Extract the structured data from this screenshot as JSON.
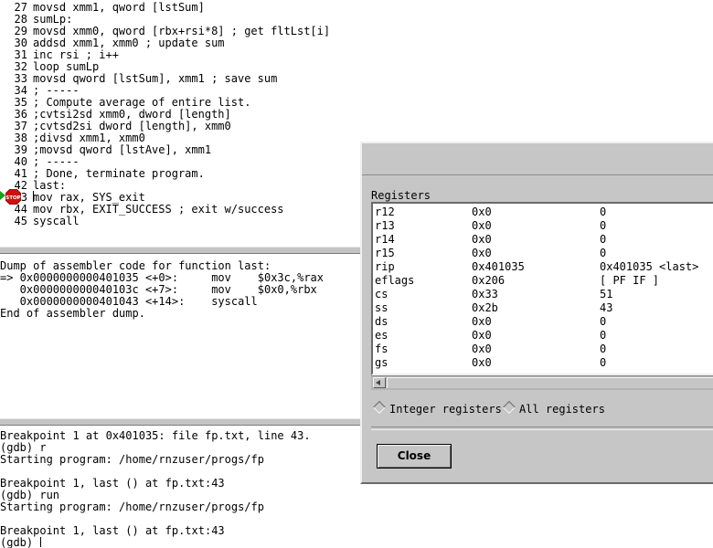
{
  "source": {
    "lines": [
      {
        "num": "27",
        "text": "movsd xmm1, qword [lstSum]"
      },
      {
        "num": "28",
        "text": "sumLp:"
      },
      {
        "num": "29",
        "text": "movsd xmm0, qword [rbx+rsi*8] ; get fltLst[i]"
      },
      {
        "num": "30",
        "text": "addsd xmm1, xmm0 ; update sum"
      },
      {
        "num": "31",
        "text": "inc rsi ; i++"
      },
      {
        "num": "32",
        "text": "loop sumLp"
      },
      {
        "num": "33",
        "text": "movsd qword [lstSum], xmm1 ; save sum"
      },
      {
        "num": "34",
        "text": "; -----"
      },
      {
        "num": "35",
        "text": "; Compute average of entire list."
      },
      {
        "num": "36",
        "text": ";cvtsi2sd xmm0, dword [length]"
      },
      {
        "num": "37",
        "text": ";cvtsd2si dword [length], xmm0"
      },
      {
        "num": "38",
        "text": ";divsd xmm1, xmm0"
      },
      {
        "num": "39",
        "text": ";movsd qword [lstAve], xmm1"
      },
      {
        "num": "40",
        "text": "; -----"
      },
      {
        "num": "41",
        "text": "; Done, terminate program."
      },
      {
        "num": "42",
        "text": "last:"
      },
      {
        "num": "43",
        "text": "mov rax, SYS_exit"
      },
      {
        "num": "44",
        "text": "mov rbx, EXIT_SUCCESS ; exit w/success"
      },
      {
        "num": "45",
        "text": "syscall"
      }
    ],
    "stop_label": "STOP"
  },
  "assembly": {
    "lines": [
      "Dump of assembler code for function last:",
      "=> 0x0000000000401035 <+0>:     mov    $0x3c,%rax",
      "   0x000000000040103c <+7>:     mov    $0x0,%rbx",
      "   0x0000000000401043 <+14>:    syscall",
      "End of assembler dump."
    ]
  },
  "console": {
    "lines": [
      "Breakpoint 1 at 0x401035: file fp.txt, line 43.",
      "(gdb) r",
      "Starting program: /home/rnzuser/progs/fp",
      "",
      "Breakpoint 1, last () at fp.txt:43",
      "(gdb) run",
      "Starting program: /home/rnzuser/progs/fp",
      "",
      "Breakpoint 1, last () at fp.txt:43",
      "(gdb) "
    ]
  },
  "registers_dialog": {
    "title": "Registers",
    "rows": [
      {
        "name": "r12",
        "hex": "0x0",
        "natural": "0"
      },
      {
        "name": "r13",
        "hex": "0x0",
        "natural": "0"
      },
      {
        "name": "r14",
        "hex": "0x0",
        "natural": "0"
      },
      {
        "name": "r15",
        "hex": "0x0",
        "natural": "0"
      },
      {
        "name": "rip",
        "hex": "0x401035",
        "natural": "0x401035 <last>"
      },
      {
        "name": "eflags",
        "hex": "0x206",
        "natural": "[ PF IF ]"
      },
      {
        "name": "cs",
        "hex": "0x33",
        "natural": "51"
      },
      {
        "name": "ss",
        "hex": "0x2b",
        "natural": "43"
      },
      {
        "name": "ds",
        "hex": "0x0",
        "natural": "0"
      },
      {
        "name": "es",
        "hex": "0x0",
        "natural": "0"
      },
      {
        "name": "fs",
        "hex": "0x0",
        "natural": "0"
      },
      {
        "name": "gs",
        "hex": "0x0",
        "natural": "0"
      }
    ],
    "radio_integer": "Integer registers",
    "radio_all": "All registers",
    "close_label": "Close"
  },
  "colors": {
    "stop_sign": "#cc1111",
    "exec_arrow": "#17a317",
    "dialog_bg": "#c6c6c6"
  }
}
